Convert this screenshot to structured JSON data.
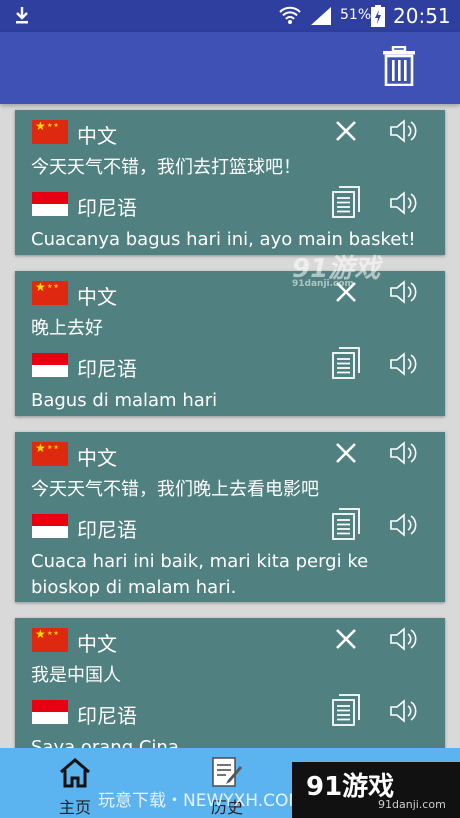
{
  "status_bar": {
    "battery": "51%",
    "time": "20:51"
  },
  "cards": [
    {
      "src_lang": "中文",
      "src_text": "今天天气不错，我们去打篮球吧！",
      "dst_lang": "印尼语",
      "dst_text": "Cuacanya bagus hari ini, ayo main basket!"
    },
    {
      "src_lang": "中文",
      "src_text": "晚上去好",
      "dst_lang": "印尼语",
      "dst_text": "Bagus di malam hari"
    },
    {
      "src_lang": "中文",
      "src_text": "今天天气不错，我们晚上去看电影吧",
      "dst_lang": "印尼语",
      "dst_text": "Cuaca hari ini baik, mari kita pergi ke bioskop di malam hari."
    },
    {
      "src_lang": "中文",
      "src_text": "我是中国人",
      "dst_lang": "印尼语",
      "dst_text": "Saya orang Cina"
    }
  ],
  "bottom_nav": {
    "home": "主页",
    "history": "历史"
  },
  "watermark": {
    "text": "玩意下载・NEWYXH.COM.CN",
    "logo": "91游戏",
    "logo_url": "91danji.com",
    "logo_small": "91danji.com"
  }
}
